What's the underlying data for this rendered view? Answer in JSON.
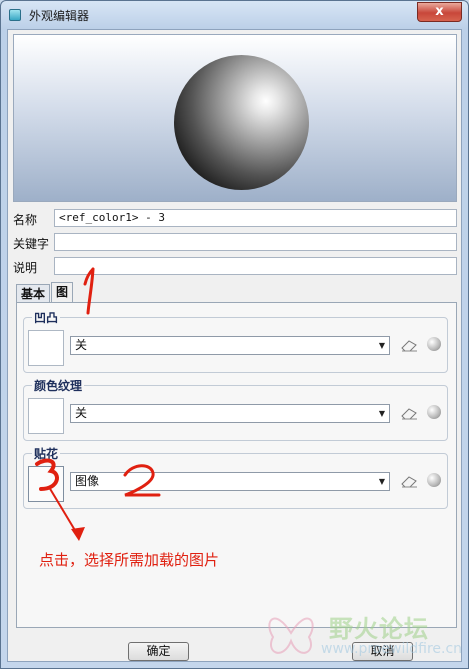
{
  "window": {
    "title": "外观编辑器",
    "close_glyph": "x"
  },
  "form": {
    "name_label": "名称",
    "name_value": "<ref_color1> - 3",
    "keyword_label": "关键字",
    "keyword_value": "",
    "desc_label": "说明",
    "desc_value": ""
  },
  "tabs": [
    {
      "label": "基本",
      "active": false
    },
    {
      "label": "图",
      "active": true
    }
  ],
  "groups": [
    {
      "title": "凹凸",
      "select_value": "关"
    },
    {
      "title": "颜色纹理",
      "select_value": "关"
    },
    {
      "title": "贴花",
      "select_value": "图像"
    }
  ],
  "buttons": {
    "ok": "确定",
    "cancel": "取消"
  },
  "annotations": {
    "mark1": "1",
    "mark2": "2",
    "mark3": "3",
    "instruction": "点击，选择所需加载的图片",
    "color": "#e02010"
  },
  "watermark": {
    "text_cn": "野火论坛",
    "url": "www.proewildfire.cn"
  }
}
